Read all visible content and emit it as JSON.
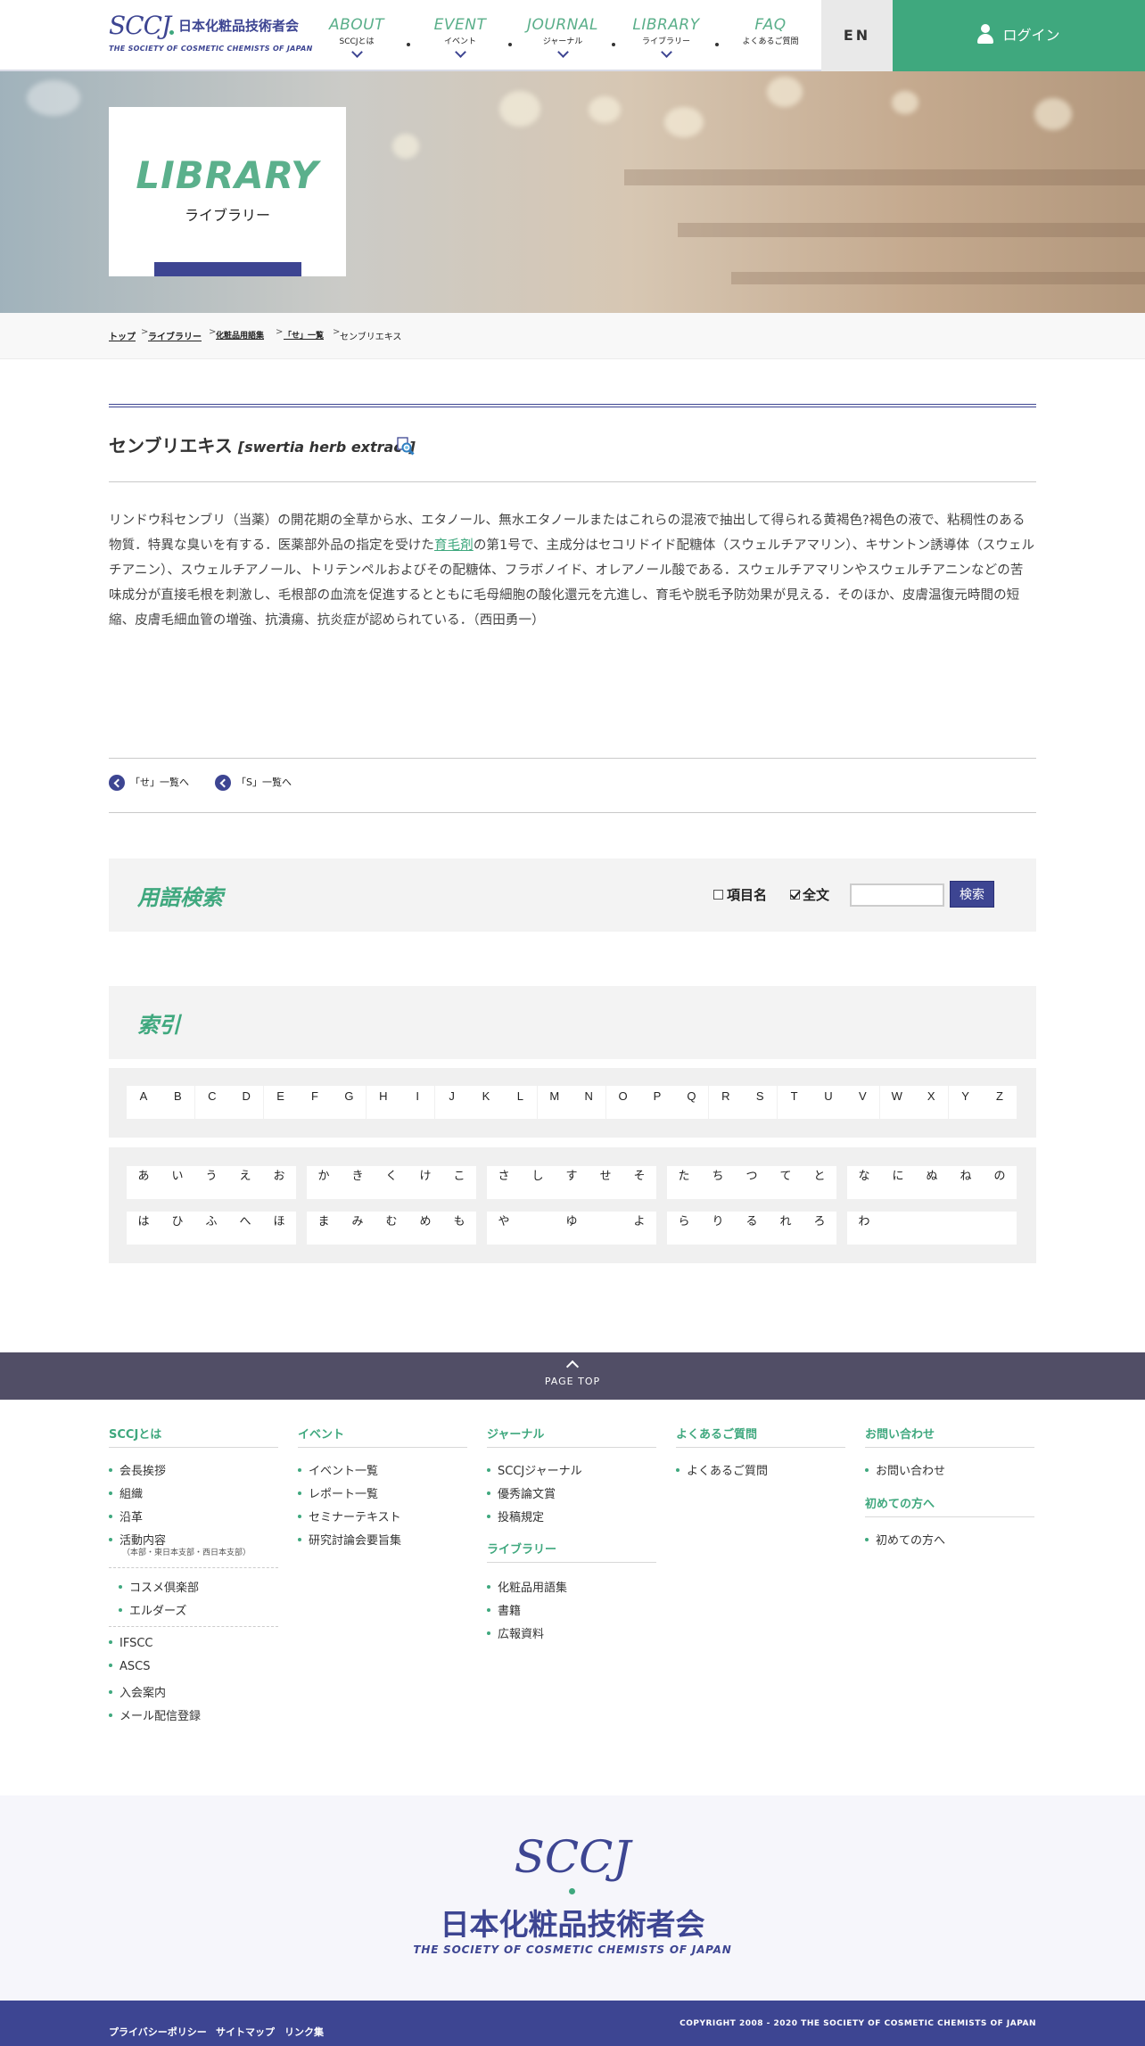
{
  "header": {
    "logo_mark": "SCCJ",
    "logo_jp": "日本化粧品技術者会",
    "logo_en": "THE SOCIETY OF COSMETIC CHEMISTS OF JAPAN",
    "nav": [
      {
        "en": "ABOUT",
        "jp": "SCCJとは"
      },
      {
        "en": "EVENT",
        "jp": "イベント"
      },
      {
        "en": "JOURNAL",
        "jp": "ジャーナル"
      },
      {
        "en": "LIBRARY",
        "jp": "ライブラリー"
      },
      {
        "en": "FAQ",
        "jp": "よくあるご質問"
      }
    ],
    "lang": "EN",
    "login": "ログイン"
  },
  "hero": {
    "title": "LIBRARY",
    "subtitle": "ライブラリー"
  },
  "breadcrumb": [
    "トップ",
    "ライブラリー",
    "化粧品用語集",
    "「せ」一覧",
    "センブリエキス"
  ],
  "term": {
    "name": "センブリエキス",
    "english": "[swertia herb extract]",
    "body_before": "リンドウ科センブリ（当薬）の開花期の全草から水、エタノール、無水エタノールまたはこれらの混液で抽出して得られる黄褐色?褐色の液で、粘稠性のある物質．特異な臭いを有する．医薬部外品の指定を受けた",
    "body_link": "育毛剤",
    "body_after": "の第1号で、主成分はセコリドイド配糖体（スウェルチアマリン）、キサントン誘導体（スウェルチアニン）、スウェルチアノール、トリテンペルおよびその配糖体、フラボノイド、オレアノール酸である．スウェルチアマリンやスウェルチアニンなどの苦味成分が直接毛根を刺激し、毛根部の血流を促進するとともに毛母細胞の酸化還元を亢進し、育毛や脱毛予防効果が見える．そのほか、皮膚温復元時間の短縮、皮膚毛細血管の増強、抗潰瘍、抗炎症が認められている．（西田勇一）"
  },
  "back_links": [
    "「せ」一覧へ",
    "「S」一覧へ"
  ],
  "search": {
    "title": "用語検索",
    "opt_item": "項目名",
    "opt_full": "全文",
    "query": "",
    "button": "検索"
  },
  "index": {
    "title": "索引",
    "latin": [
      "A",
      "B",
      "C",
      "D",
      "E",
      "F",
      "G",
      "H",
      "I",
      "J",
      "K",
      "L",
      "M",
      "N",
      "O",
      "P",
      "Q",
      "R",
      "S",
      "T",
      "U",
      "V",
      "W",
      "X",
      "Y",
      "Z"
    ],
    "kana_row1": [
      "あ",
      "い",
      "う",
      "え",
      "お",
      "か",
      "き",
      "く",
      "け",
      "こ",
      "さ",
      "し",
      "す",
      "せ",
      "そ",
      "た",
      "ち",
      "つ",
      "て",
      "と",
      "な",
      "に",
      "ぬ",
      "ね",
      "の"
    ],
    "kana_row2": [
      "は",
      "ひ",
      "ふ",
      "へ",
      "ほ",
      "ま",
      "み",
      "む",
      "め",
      "も",
      "や",
      "",
      "ゆ",
      "",
      "よ",
      "ら",
      "り",
      "る",
      "れ",
      "ろ",
      "わ",
      "",
      "",
      "",
      ""
    ]
  },
  "pagetop": "PAGE TOP",
  "sitemap": {
    "about": {
      "title": "SCCJとは",
      "items": [
        "会長挨拶",
        "組織",
        "沿革",
        "活動内容"
      ],
      "activity_note": "（本部・東日本支部・西日本支部）",
      "sub": [
        "コスメ倶楽部",
        "エルダーズ"
      ],
      "more": [
        "IFSCC",
        "ASCS",
        "入会案内",
        "メール配信登録"
      ]
    },
    "event": {
      "title": "イベント",
      "items": [
        "イベント一覧",
        "レポート一覧",
        "セミナーテキスト",
        "研究討論会要旨集"
      ]
    },
    "journal": {
      "title": "ジャーナル",
      "items": [
        "SCCJジャーナル",
        "優秀論文賞",
        "投稿規定"
      ]
    },
    "library": {
      "title": "ライブラリー",
      "items": [
        "化粧品用語集",
        "書籍",
        "広報資料"
      ]
    },
    "faq": {
      "title": "よくあるご質問",
      "items": [
        "よくあるご質問"
      ]
    },
    "contact": {
      "title": "お問い合わせ",
      "items": [
        "お問い合わせ"
      ]
    },
    "first": {
      "title": "初めての方へ",
      "items": [
        "初めての方へ"
      ]
    }
  },
  "footer": {
    "logo_mark": "SCCJ",
    "jp": "日本化粧品技術者会",
    "en": "THE SOCIETY OF COSMETIC CHEMISTS OF JAPAN",
    "links": [
      "プライバシーポリシー",
      "サイトマップ",
      "リンク集"
    ],
    "copyright": "COPYRIGHT 2008 - 2020 THE SOCIETY OF COSMETIC CHEMISTS OF JAPAN"
  },
  "colors": {
    "brand_blue": "#3d4592",
    "brand_green": "#3fa87e",
    "pagetop_bg": "#514e66"
  }
}
